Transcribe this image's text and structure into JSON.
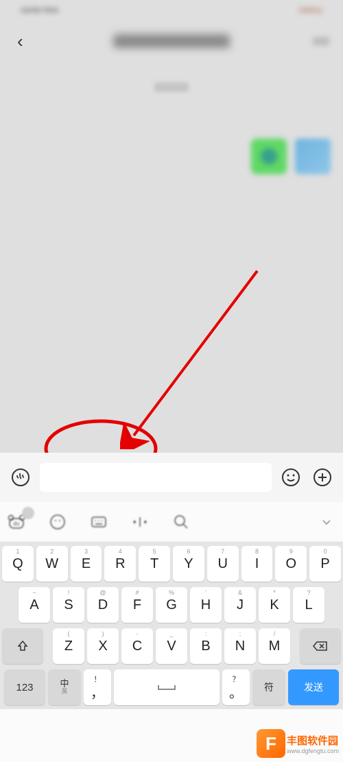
{
  "status": {
    "left": "carrier time",
    "right": "battery"
  },
  "header": {
    "back": "‹"
  },
  "input": {
    "placeholder": ""
  },
  "kb_toolbar": {
    "tools": [
      "bear",
      "emoji",
      "keyboard",
      "cursor",
      "search"
    ]
  },
  "keys": {
    "row1": [
      {
        "k": "Q",
        "s": "1"
      },
      {
        "k": "W",
        "s": "2"
      },
      {
        "k": "E",
        "s": "3"
      },
      {
        "k": "R",
        "s": "4"
      },
      {
        "k": "T",
        "s": "5"
      },
      {
        "k": "Y",
        "s": "6"
      },
      {
        "k": "U",
        "s": "7"
      },
      {
        "k": "I",
        "s": "8"
      },
      {
        "k": "O",
        "s": "9"
      },
      {
        "k": "P",
        "s": "0"
      }
    ],
    "row2": [
      {
        "k": "A",
        "s": "~"
      },
      {
        "k": "S",
        "s": "!"
      },
      {
        "k": "D",
        "s": "@"
      },
      {
        "k": "F",
        "s": "#"
      },
      {
        "k": "G",
        "s": "%"
      },
      {
        "k": "H",
        "s": "'"
      },
      {
        "k": "J",
        "s": "&"
      },
      {
        "k": "K",
        "s": "*"
      },
      {
        "k": "L",
        "s": "?"
      }
    ],
    "row3": [
      {
        "k": "Z",
        "s": "("
      },
      {
        "k": "X",
        "s": ")"
      },
      {
        "k": "C",
        "s": "-"
      },
      {
        "k": "V",
        "s": "_"
      },
      {
        "k": "B",
        "s": ":"
      },
      {
        "k": "N",
        "s": ";"
      },
      {
        "k": "M",
        "s": "/"
      }
    ]
  },
  "bottom": {
    "num": "123",
    "lang_top": "中",
    "lang_bot": "英",
    "comma_sup": "！",
    "comma": "，",
    "period_sup": "？",
    "period": "。",
    "quick": "符",
    "send": "发送"
  },
  "watermark": {
    "logo": "F",
    "top": "丰图软件园",
    "bot": "www.dgfengtu.com"
  }
}
